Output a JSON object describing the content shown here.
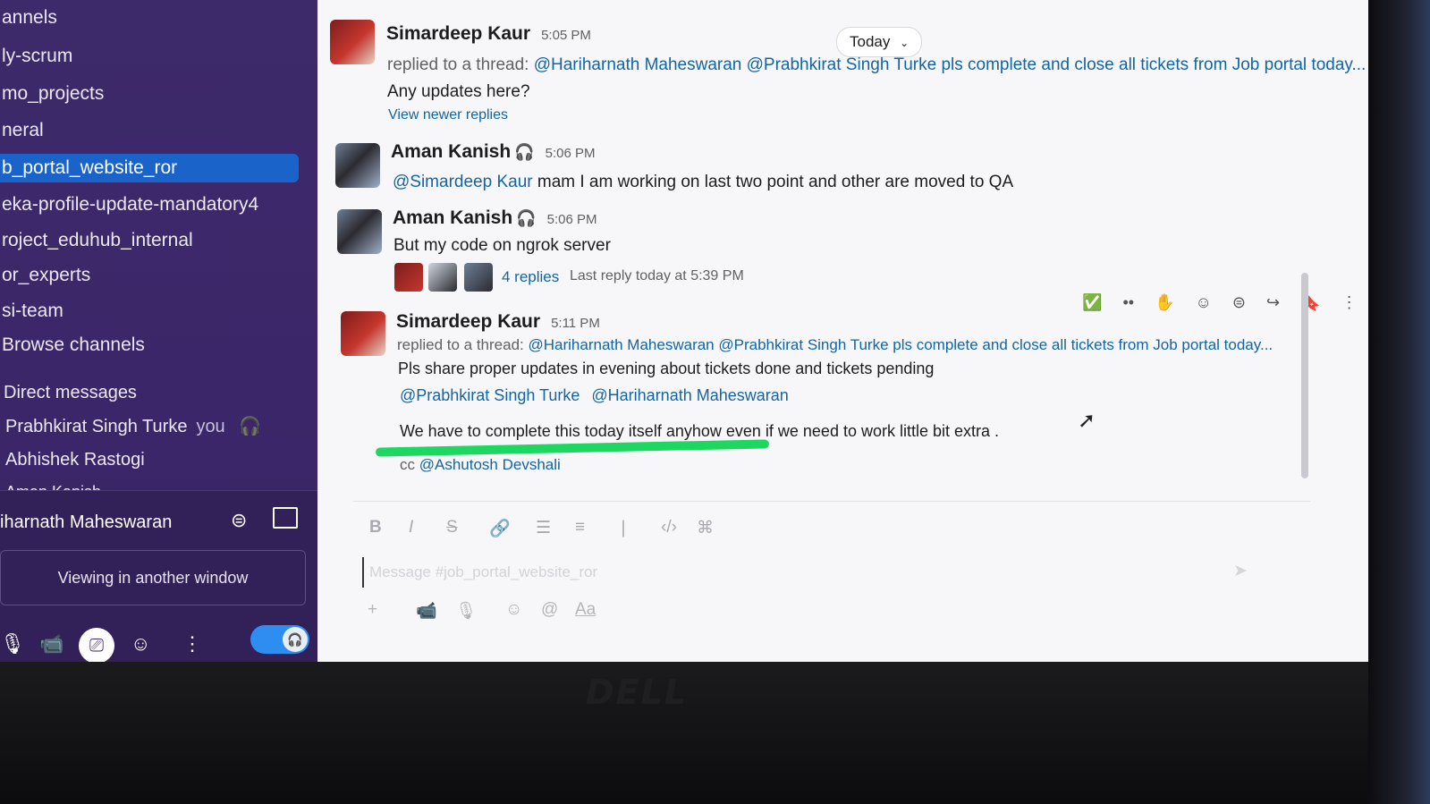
{
  "sidebar": {
    "channels": [
      {
        "label": "annels"
      },
      {
        "label": "ly-scrum"
      },
      {
        "label": "mo_projects"
      },
      {
        "label": "neral"
      },
      {
        "label": "b_portal_website_ror",
        "active": true
      },
      {
        "label": "eka-profile-update-mandatory4"
      },
      {
        "label": "roject_eduhub_internal"
      },
      {
        "label": "or_experts"
      },
      {
        "label": "si-team"
      },
      {
        "label": "Browse channels"
      }
    ],
    "dm_header": "Direct messages",
    "dms": [
      {
        "name": "Prabhkirat Singh Turke",
        "suffix": "you"
      },
      {
        "name": "Abhishek Rastogi"
      },
      {
        "name": "Aman Kanish"
      }
    ]
  },
  "huddle": {
    "name": "iharnath Maheswaran",
    "viewing_label": "Viewing in another window"
  },
  "header": {
    "date_pill": "Today"
  },
  "messages": [
    {
      "sender": "Simardeep Kaur",
      "time": "5:05 PM",
      "reply_prefix": "replied to a thread:",
      "reply_text": "@Hariharnath Maheswaran @Prabhkirat Singh Turke pls complete and close all tickets from Job portal today...",
      "body": "Any updates here?",
      "link": "View newer replies"
    },
    {
      "sender": "Aman Kanish",
      "time": "5:06 PM",
      "mention": "@Simardeep Kaur",
      "body": "mam I am working on last two point and other are moved to QA"
    },
    {
      "sender": "Aman Kanish",
      "time": "5:06 PM",
      "body": "But my code on ngrok server",
      "replies": "4 replies",
      "last_reply": "Last reply today at 5:39 PM"
    },
    {
      "sender": "Simardeep Kaur",
      "time": "5:11 PM",
      "reply_prefix": "replied to a thread:",
      "reply_text": "@Hariharnath Maheswaran @Prabhkirat Singh Turke pls complete and close all tickets from Job portal today...",
      "body": "Pls share proper updates in evening about tickets done and tickets pending",
      "mention_1": "@Prabhkirat Singh Turke",
      "mention_2": "@Hariharnath Maheswaran",
      "body_2": "We have to complete this today itself anyhow even if we need to work little bit extra .",
      "cc_prefix": "cc",
      "cc_mention": "@Ashutosh Devshali"
    }
  ],
  "composer": {
    "placeholder": "Message #job_portal_website_ror",
    "format_buttons": [
      "B",
      "I",
      "S"
    ],
    "aa_label": "Aa"
  },
  "brand": "DELL",
  "colors": {
    "sidebar": "#3b2669",
    "active_channel": "#1a63c9",
    "mention": "#1264a3",
    "highlight": "#1ed760"
  }
}
